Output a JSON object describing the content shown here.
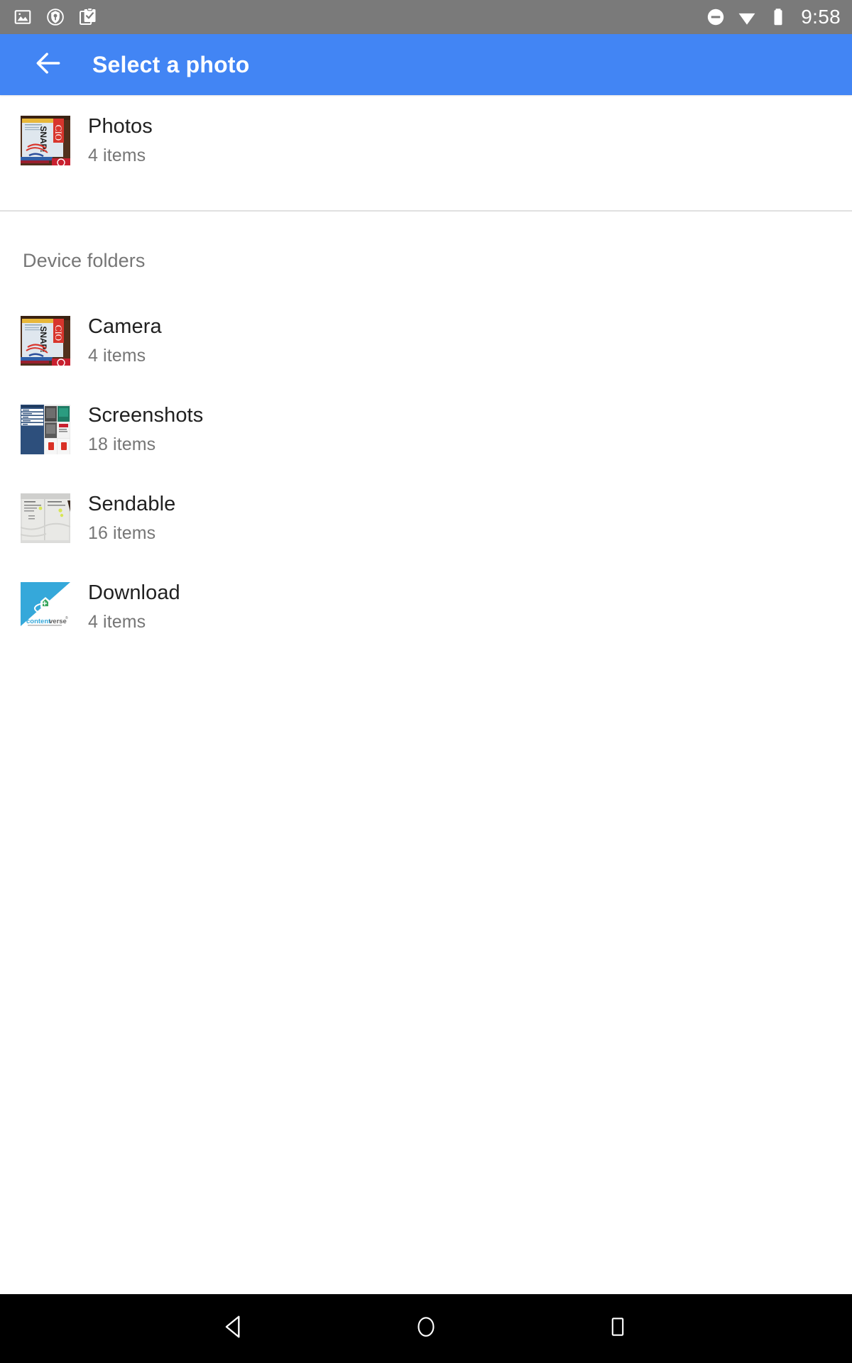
{
  "status_bar": {
    "background": "#7a7a7a",
    "time": "9:58",
    "left_icons": [
      {
        "name": "image-icon"
      },
      {
        "name": "location-shield-icon"
      },
      {
        "name": "clipboard-check-icon"
      }
    ],
    "right_icons": [
      {
        "name": "do-not-disturb-icon"
      },
      {
        "name": "wifi-icon"
      },
      {
        "name": "battery-icon"
      }
    ]
  },
  "app_bar": {
    "background": "#4285f4",
    "title": "Select a photo",
    "back_icon": "arrow-back-icon"
  },
  "photos_entry": {
    "title": "Photos",
    "subtitle": "4 items",
    "thumbnail": "magazine-cover-thumbnail"
  },
  "device_folders": {
    "header": "Device folders",
    "items": [
      {
        "title": "Camera",
        "subtitle": "4 items",
        "thumbnail": "magazine-cover-thumbnail"
      },
      {
        "title": "Screenshots",
        "subtitle": "18 items",
        "thumbnail": "screenshot-grid-thumbnail"
      },
      {
        "title": "Sendable",
        "subtitle": "16 items",
        "thumbnail": "paper-receipt-thumbnail"
      },
      {
        "title": "Download",
        "subtitle": "4 items",
        "thumbnail": "contentverse-logo-thumbnail"
      }
    ]
  },
  "nav_bar": {
    "background": "#000000",
    "buttons": [
      {
        "name": "nav-back-button",
        "icon": "triangle-back-icon"
      },
      {
        "name": "nav-home-button",
        "icon": "circle-home-icon"
      },
      {
        "name": "nav-recents-button",
        "icon": "square-recents-icon"
      }
    ]
  },
  "colors": {
    "accent": "#4285f4",
    "status_bar": "#7a7a7a",
    "divider": "#e0e0e0",
    "primary_text": "#212121",
    "secondary_text": "#767676"
  }
}
